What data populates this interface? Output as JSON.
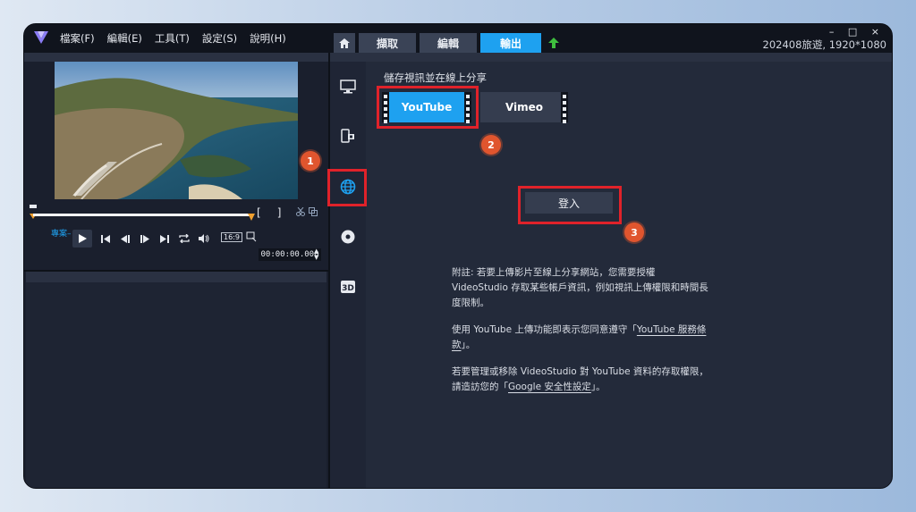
{
  "menu": {
    "items": [
      "檔案(F)",
      "編輯(E)",
      "工具(T)",
      "設定(S)",
      "說明(H)"
    ]
  },
  "tabs": {
    "capture": "擷取",
    "edit": "編輯",
    "output": "輸出"
  },
  "window_controls": "– □ ×",
  "project_title": "202408旅遊, 1920*1080",
  "player": {
    "project_label": "專案–",
    "aspect_label": "16:9",
    "timecode": "00:00:00.000"
  },
  "share": {
    "section_title": "儲存視訊並在線上分享",
    "youtube_label": "YouTube",
    "vimeo_label": "Vimeo",
    "login_label": "登入"
  },
  "notes": {
    "p1": "附註: 若要上傳影片至線上分享網站，您需要授權 VideoStudio 存取某些帳戶資訊，例如視訊上傳權限和時間長度限制。",
    "p2_prefix": "使用 YouTube 上傳功能即表示您同意遵守「",
    "p2_link": "YouTube 服務條款",
    "p2_suffix": "」。",
    "p3_prefix": "若要管理或移除 VideoStudio 對 YouTube 資料的存取權限，請造訪您的「",
    "p3_link": "Google 安全性設定",
    "p3_suffix": "」。"
  },
  "annotations": {
    "badge1": "1",
    "badge2": "2",
    "badge3": "3"
  },
  "colors": {
    "accent": "#1ea1f0",
    "highlight": "#e0222a",
    "badge": "#e0552e"
  }
}
